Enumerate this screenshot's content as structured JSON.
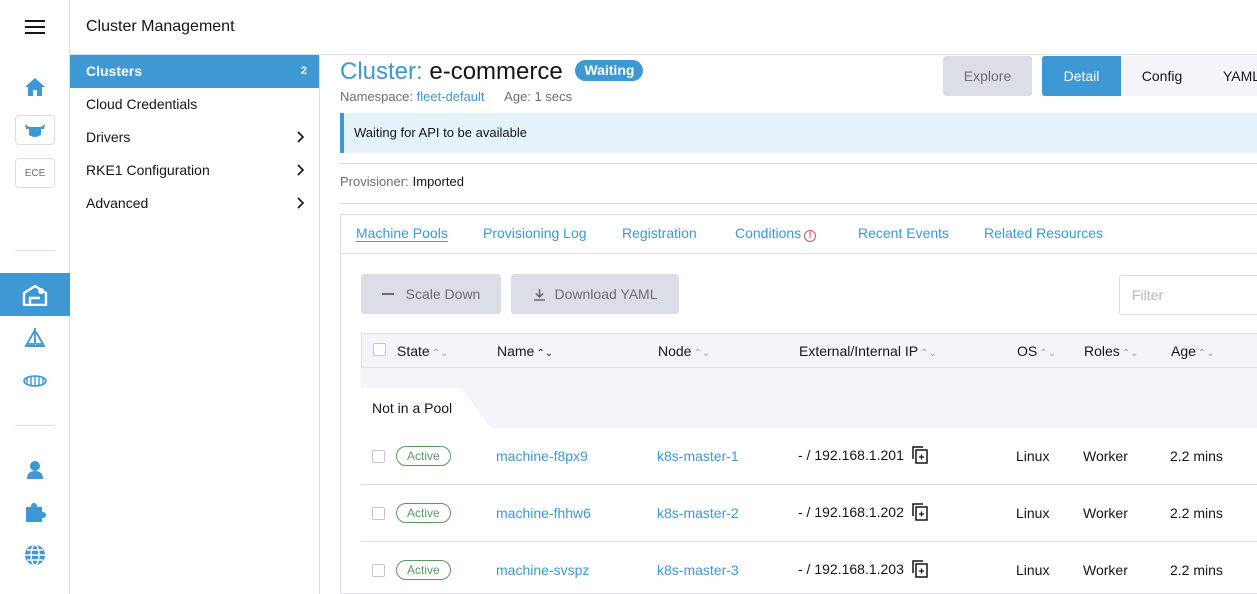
{
  "header": {
    "title": "Cluster Management"
  },
  "rail": {
    "ece_label": "ECE"
  },
  "sidenav": {
    "items": [
      {
        "label": "Clusters",
        "count": "2",
        "active": true
      },
      {
        "label": "Cloud Credentials"
      },
      {
        "label": "Drivers",
        "chevron": ">"
      },
      {
        "label": "RKE1 Configuration",
        "chevron": ">"
      },
      {
        "label": "Advanced",
        "chevron": ">"
      }
    ]
  },
  "cluster": {
    "kind": "Cluster:",
    "name": "e-commerce",
    "status": "Waiting",
    "namespace_label": "Namespace:",
    "namespace": "fleet-default",
    "age_label": "Age:",
    "age": "1 secs"
  },
  "actions": {
    "explore": "Explore",
    "views": [
      "Detail",
      "Config",
      "YAML"
    ]
  },
  "banner": {
    "text": "Waiting for API to be available"
  },
  "provisioner": {
    "label": "Provisioner:",
    "value": "Imported"
  },
  "tabs": [
    {
      "label": "Machine Pools"
    },
    {
      "label": "Provisioning Log"
    },
    {
      "label": "Registration"
    },
    {
      "label": "Conditions"
    },
    {
      "label": "Recent Events"
    },
    {
      "label": "Related Resources"
    }
  ],
  "toolbar": {
    "scale_down": "Scale Down",
    "download_yaml": "Download YAML",
    "filter_placeholder": "Filter"
  },
  "table": {
    "columns": [
      "State",
      "Name",
      "Node",
      "External/Internal IP",
      "OS",
      "Roles",
      "Age"
    ],
    "group_label": "Not in a Pool",
    "rows": [
      {
        "state": "Active",
        "name": "machine-f8px9",
        "node": "k8s-master-1",
        "ip": "- / 192.168.1.201",
        "os": "Linux",
        "roles": "Worker",
        "age": "2.2 mins"
      },
      {
        "state": "Active",
        "name": "machine-fhhw6",
        "node": "k8s-master-2",
        "ip": "- / 192.168.1.202",
        "os": "Linux",
        "roles": "Worker",
        "age": "2.2 mins"
      },
      {
        "state": "Active",
        "name": "machine-svspz",
        "node": "k8s-master-3",
        "ip": "- / 192.168.1.203",
        "os": "Linux",
        "roles": "Worker",
        "age": "2.2 mins"
      }
    ]
  },
  "colors": {
    "accent": "#3d98d3",
    "active_green": "#5d995d",
    "warning_red": "#d9534f"
  }
}
